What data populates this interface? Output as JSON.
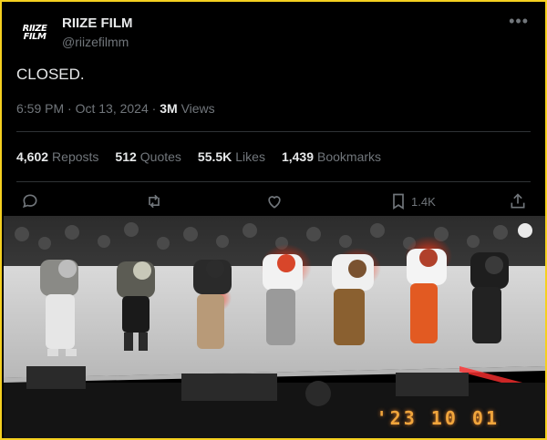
{
  "author": {
    "avatar_text_line1": "RIIZE",
    "avatar_text_line2": "FILM",
    "display_name": "RIIZE FILM",
    "handle": "@riizefilmm"
  },
  "post": {
    "text": "CLOSED.",
    "time": "6:59 PM",
    "date": "Oct 13, 2024",
    "views_count": "3M",
    "views_label": "Views",
    "separator_dot": "·"
  },
  "stats": [
    {
      "value": "4,602",
      "label": "Reposts"
    },
    {
      "value": "512",
      "label": "Quotes"
    },
    {
      "value": "55.5K",
      "label": "Likes"
    },
    {
      "value": "1,439",
      "label": "Bookmarks"
    }
  ],
  "actions": {
    "reply_icon": "reply-icon",
    "repost_icon": "repost-icon",
    "like_icon": "heart-icon",
    "bookmark_icon": "bookmark-icon",
    "bookmark_count": "1.4K",
    "share_icon": "share-icon"
  },
  "photo": {
    "timestamp": "'23 10 01"
  },
  "colors": {
    "background": "#000000",
    "frame": "#f5d020",
    "text_primary": "#e7e9ea",
    "text_secondary": "#71767b",
    "stamp": "#f0a53c"
  }
}
